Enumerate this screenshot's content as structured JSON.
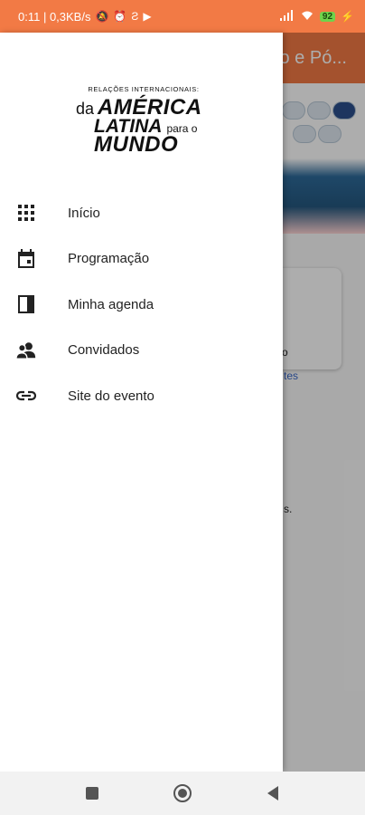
{
  "status_bar": {
    "time_info": "0:11 | 0,3KB/s",
    "battery": "92"
  },
  "background": {
    "header_title": "o e Pó...",
    "card_text": "o",
    "card_link": "tes",
    "body_text": "s."
  },
  "drawer": {
    "brand": {
      "top": "RELAÇÕES INTERNACIONAIS:",
      "da": "da",
      "america": "AMÉRICA",
      "latina": "LATINA",
      "para": "para o",
      "mundo": "MUNDO"
    },
    "menu": [
      {
        "label": "Início",
        "icon": "apps-grid-icon"
      },
      {
        "label": "Programação",
        "icon": "calendar-icon"
      },
      {
        "label": "Minha agenda",
        "icon": "agenda-book-icon"
      },
      {
        "label": "Convidados",
        "icon": "people-icon"
      },
      {
        "label": "Site do evento",
        "icon": "link-icon"
      }
    ]
  },
  "colors": {
    "accent": "#f27a45",
    "scrim": "rgba(0,0,0,0.32)"
  }
}
